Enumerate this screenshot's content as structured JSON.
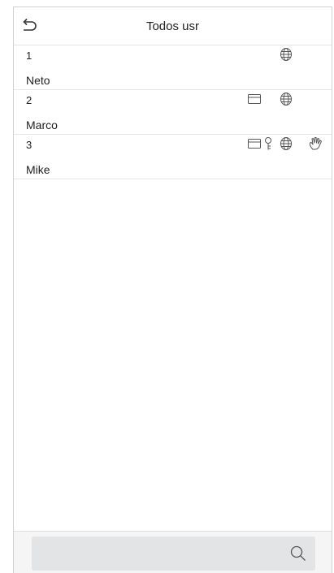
{
  "header": {
    "title": "Todos usr",
    "back_icon": "back-arrow-icon"
  },
  "users": [
    {
      "id": "1",
      "name": "Neto",
      "icons": [
        "face-icon"
      ]
    },
    {
      "id": "2",
      "name": "Marco",
      "icons": [
        "card-icon",
        "face-icon"
      ]
    },
    {
      "id": "3",
      "name": "Mike",
      "icons": [
        "card-icon",
        "password-key-icon",
        "face-icon",
        "palm-icon"
      ]
    }
  ],
  "search": {
    "icon": "search-icon"
  },
  "colors": {
    "divider": "#e6e6e6",
    "search_field": "#e2e4e6",
    "icon_stroke": "#555555"
  }
}
